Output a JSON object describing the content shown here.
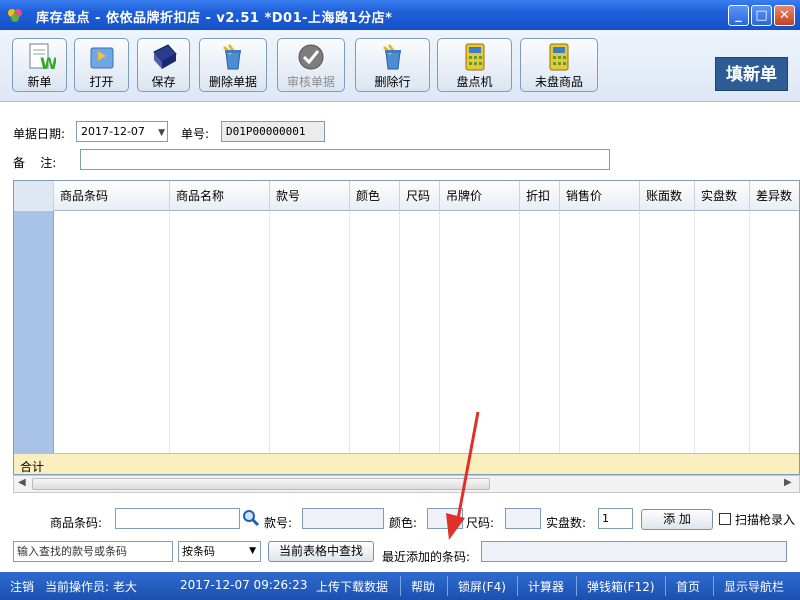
{
  "window": {
    "title": "库存盘点 - 依依品牌折扣店 - v2.51  *D01-上海路1分店*",
    "min_icon": "minimize-icon",
    "max_icon": "maximize-icon",
    "close_icon": "close-icon"
  },
  "toolbar": {
    "buttons": [
      {
        "label": "新单",
        "icon": "new-document-icon"
      },
      {
        "label": "打开",
        "icon": "open-folder-icon"
      },
      {
        "label": "保存",
        "icon": "save-icon"
      },
      {
        "label": "删除单据",
        "icon": "delete-document-icon"
      },
      {
        "label": "审核单据",
        "icon": "audit-check-icon",
        "disabled": true
      },
      {
        "label": "删除行",
        "icon": "delete-row-icon"
      },
      {
        "label": "盘点机",
        "icon": "calculator-icon"
      },
      {
        "label": "未盘商品",
        "icon": "calculator-icon"
      }
    ],
    "fill_new": "填新单"
  },
  "form": {
    "date_label": "单据日期:",
    "date_value": "2017-12-07",
    "no_label": "单号:",
    "no_value": "D01P00000001",
    "remark_label": "备    注:",
    "remark_value": ""
  },
  "grid": {
    "columns": [
      "商品条码",
      "商品名称",
      "款号",
      "颜色",
      "尺码",
      "吊牌价",
      "折扣",
      "销售价",
      "账面数",
      "实盘数",
      "差异数"
    ],
    "rows": [],
    "total_label": "合计"
  },
  "entry": {
    "barcode_label": "商品条码:",
    "barcode_value": "",
    "style_label": "款号:",
    "style_value": "",
    "color_label": "颜色:",
    "color_value": "",
    "size_label": "尺码:",
    "size_value": "",
    "actual_label": "实盘数:",
    "actual_value": "1",
    "add_button": "添 加",
    "scanner_label": "扫描枪录入",
    "scanner_checked": false
  },
  "search": {
    "input_value": "输入查找的款号或条码",
    "mode_value": "按条码",
    "find_button": "当前表格中查找",
    "last_added_label": "最近添加的条码:",
    "last_added_value": ""
  },
  "status": {
    "logout": "注销",
    "operator": "当前操作员: 老大",
    "datetime": "2017-12-07 09:26:23",
    "upload": "上传下载数据",
    "help": "帮助",
    "lock": "锁屏(F4)",
    "calc": "计算器",
    "cashbox": "弹钱箱(F12)",
    "home": "首页",
    "nav": "显示导航栏"
  },
  "colors": {
    "title_bar": "#1e5fd8",
    "status_bar": "#1b4fb0",
    "grid_row_header": "#a9c3e6",
    "total_row": "#fbefc0",
    "fill_new_bg": "#2d5d94",
    "annotation_arrow": "#e0302a"
  }
}
